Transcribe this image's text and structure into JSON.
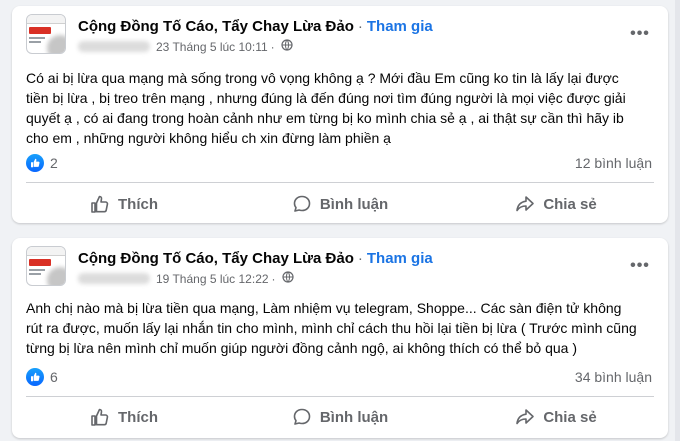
{
  "colors": {
    "link": "#1b74e4",
    "text": "#050505",
    "muted": "#65676b",
    "like_blue": "#0866ff",
    "background": "#f0f2f5"
  },
  "posts": [
    {
      "group_name": "Cộng Đồng Tố Cáo, Tẩy Chay Lừa Đảo",
      "separator": "·",
      "join_label": "Tham gia",
      "timestamp": "23 Tháng 5 lúc 10:11",
      "meta_separator": "·",
      "privacy_icon": "globe-icon",
      "text_lines": [
        "Có ai bị lừa qua mạng mà sống trong vô vọng không ạ ? Mới đầu Em cũng ko tin là lấy lại được",
        "tiền bị lừa , bị treo trên mạng , nhưng đúng là đến đúng nơi tìm đúng người là mọi việc được giải",
        "quyết ạ , có ai đang trong hoàn cảnh như em từng bị ko mình chia sẻ ạ , ai thật sự cần thì hãy ib",
        "cho em , những người không hiểu ch xin đừng làm phiền ạ"
      ],
      "like_count": "2",
      "comment_count": "12 bình luận",
      "actions": {
        "like": "Thích",
        "comment": "Bình luận",
        "share": "Chia sẻ"
      }
    },
    {
      "group_name": "Cộng Đồng Tố Cáo, Tẩy Chay Lừa Đảo",
      "separator": "·",
      "join_label": "Tham gia",
      "timestamp": "19 Tháng 5 lúc 12:22",
      "meta_separator": "·",
      "privacy_icon": "globe-icon",
      "text_lines": [
        "Anh chị nào mà bị lừa tiền qua mạng, Làm nhiệm vụ telegram, Shoppe... Các sàn điện tử không",
        "rút ra được, muốn lấy lại nhắn tin cho mình, mình chỉ cách thu hồi lại tiền bị lừa ( Trước mình cũng",
        "từng bị lừa nên mình chỉ muốn giúp người đồng cảnh ngộ, ai không thích có thể bỏ qua )"
      ],
      "like_count": "6",
      "comment_count": "34 bình luận",
      "actions": {
        "like": "Thích",
        "comment": "Bình luận",
        "share": "Chia sẻ"
      }
    }
  ]
}
